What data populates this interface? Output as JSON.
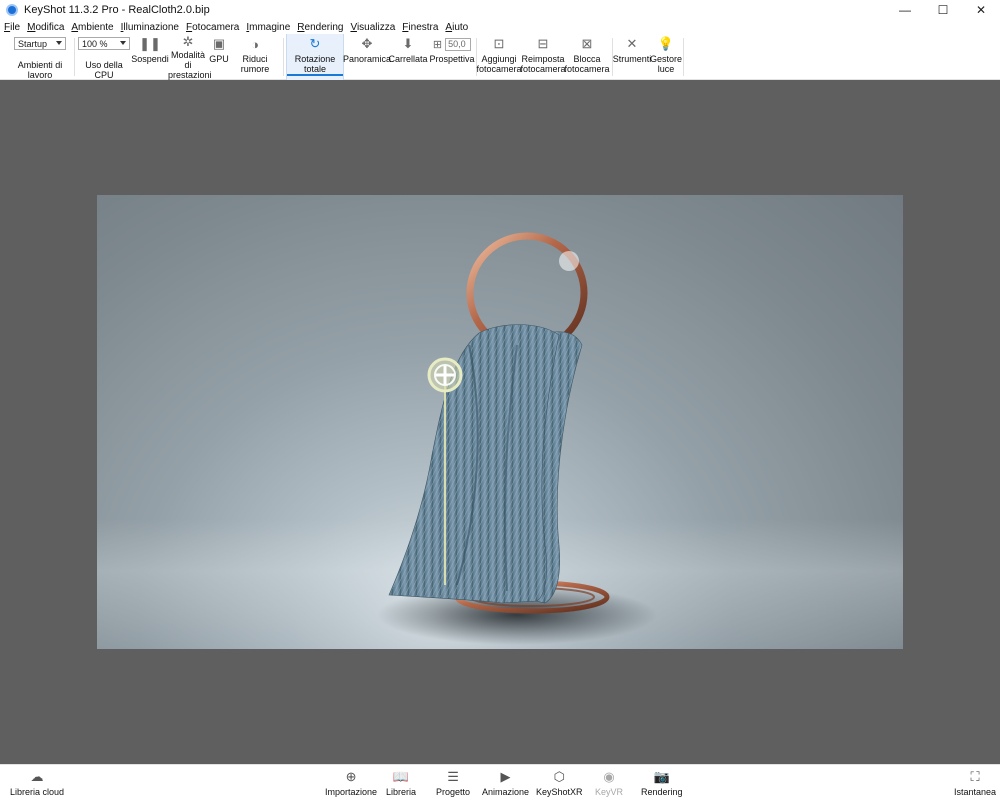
{
  "window": {
    "title": "KeyShot 11.3.2 Pro  - RealCloth2.0.bip"
  },
  "menu": [
    "File",
    "Modifica",
    "Ambiente",
    "Illuminazione",
    "Fotocamera",
    "Immagine",
    "Rendering",
    "Visualizza",
    "Finestra",
    "Aiuto"
  ],
  "toolbar": {
    "workspace_value": "Startup",
    "workspace_label": "Ambienti di lavoro",
    "cpu_value": "100 %",
    "cpu_label": "Uso della CPU",
    "pause_label": "Sospendi",
    "performance_label": "Modalità di prestazioni",
    "gpu_label": "GPU",
    "denoise_label": "Riduci rumore",
    "tumble_label": "Rotazione totale",
    "pan_label": "Panoramica",
    "dolly_label": "Carrellata",
    "perspective_label": "Prospettiva",
    "perspective_value": "50,0",
    "add_camera_label": "Aggiungi fotocamera",
    "reset_camera_label": "Reimposta fotocamera",
    "lock_camera_label": "Blocca fotocamera",
    "tools_label": "Strumenti",
    "light_manager_label": "Gestore luce"
  },
  "bottom": {
    "cloud_library": "Libreria cloud",
    "import": "Importazione",
    "library": "Libreria",
    "project": "Progetto",
    "animation": "Animazione",
    "keyshotxr": "KeyShotXR",
    "keyvr": "KeyVR",
    "rendering": "Rendering",
    "screenshot": "Istantanea"
  },
  "colors": {
    "accent": "#1a78d6",
    "viewport_bg": "#5f5f5f",
    "pivot": "#d8ddb0",
    "copper": "#b4684a"
  },
  "icons": {
    "app": "keyshot-logo-icon",
    "minimize": "minimize-icon",
    "maximize": "maximize-icon",
    "close": "close-icon"
  }
}
